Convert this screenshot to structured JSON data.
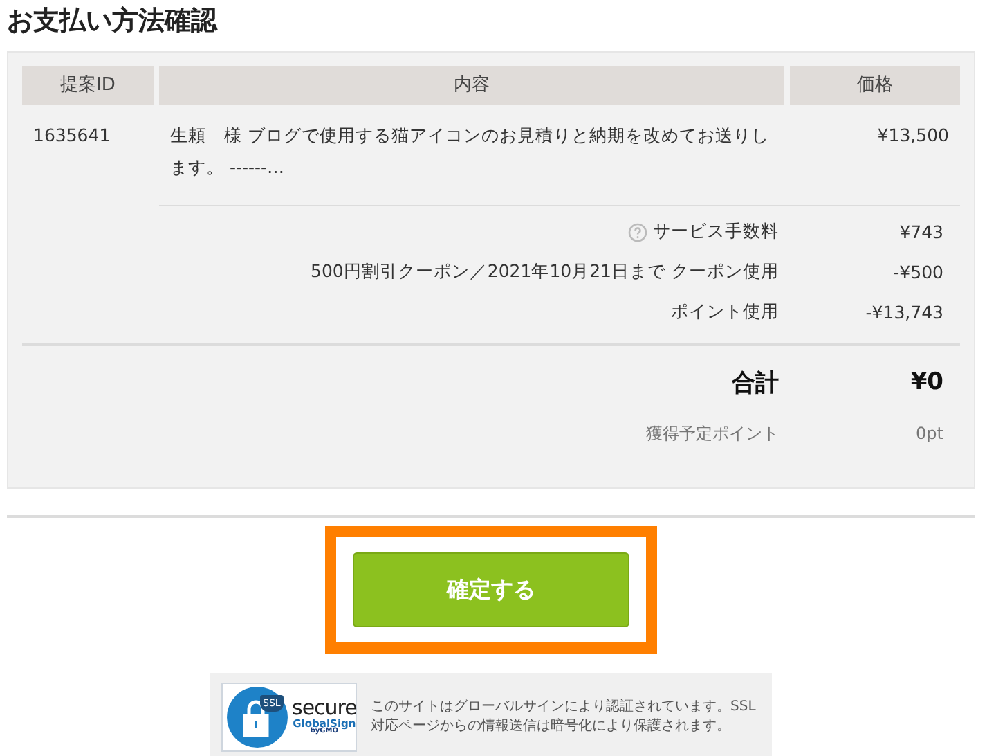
{
  "title": "お支払い方法確認",
  "table": {
    "columns": [
      "提案ID",
      "内容",
      "価格"
    ],
    "rows": [
      {
        "id": "1635641",
        "content": "生頼　様 ブログで使用する猫アイコンのお見積りと納期を改めてお送りします。 ------…",
        "price": "¥13,500"
      }
    ]
  },
  "charges": [
    {
      "label": "サービス手数料",
      "value": "¥743",
      "help": true
    },
    {
      "label": "500円割引クーポン／2021年10月21日まで クーポン使用",
      "value": "-¥500",
      "help": false
    },
    {
      "label": "ポイント使用",
      "value": "-¥13,743",
      "help": false
    }
  ],
  "total": {
    "label": "合計",
    "value": "¥0"
  },
  "points": {
    "label": "獲得予定ポイント",
    "value": "0pt"
  },
  "confirm_button": "確定する",
  "seal": {
    "badge": "SSL",
    "word": "secure",
    "brand": "GlobalSign",
    "maker": "byGMO",
    "text": "このサイトはグローバルサインにより認証されています。SSL対応ページからの情報送信は暗号化により保護されます。"
  }
}
